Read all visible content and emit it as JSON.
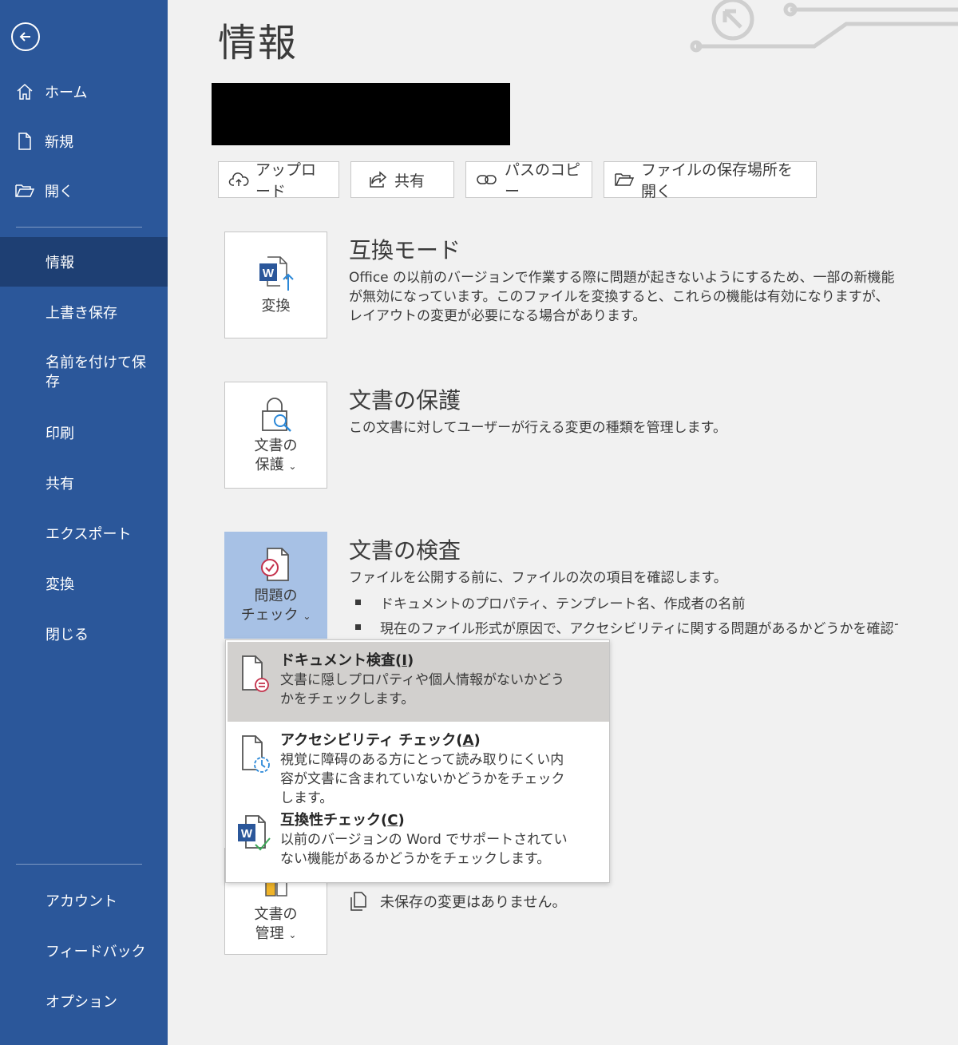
{
  "sidebar": {
    "items": [
      {
        "label": "ホーム"
      },
      {
        "label": "新規"
      },
      {
        "label": "開く"
      },
      {
        "label": "情報"
      },
      {
        "label": "上書き保存"
      },
      {
        "label": "名前を付けて保存"
      },
      {
        "label": "印刷"
      },
      {
        "label": "共有"
      },
      {
        "label": "エクスポート"
      },
      {
        "label": "変換"
      },
      {
        "label": "閉じる"
      }
    ],
    "bottom_items": [
      {
        "label": "アカウント"
      },
      {
        "label": "フィードバック"
      },
      {
        "label": "オプション"
      }
    ]
  },
  "page": {
    "title": "情報"
  },
  "toolbar": {
    "upload": "アップロード",
    "share": "共有",
    "copy_path": "パスのコピー",
    "open_location": "ファイルの保存場所を開く"
  },
  "sections": {
    "compat": {
      "button_label": "変換",
      "title": "互換モード",
      "desc": "Office の以前のバージョンで作業する際に問題が起きないようにするため、一部の新機能が無効になっています。このファイルを変換すると、これらの機能は有効になりますが、レイアウトの変更が必要になる場合があります。"
    },
    "protect": {
      "button_line1": "文書の",
      "button_line2": "保護",
      "title": "文書の保護",
      "desc": "この文書に対してユーザーが行える変更の種類を管理します。"
    },
    "inspect": {
      "button_line1": "問題の",
      "button_line2": "チェック",
      "title": "文書の検査",
      "desc": "ファイルを公開する前に、ファイルの次の項目を確認します。",
      "bullets": [
        "ドキュメントのプロパティ、テンプレート名、作成者の名前",
        "現在のファイル形式が原因で、アクセシビリティに関する問題があるかどうかを確認できな"
      ]
    },
    "manage": {
      "button_line1": "文書の",
      "button_line2": "管理",
      "status": "未保存の変更はありません。"
    }
  },
  "menu": {
    "items": [
      {
        "title": "ドキュメント検査(",
        "key": "I",
        "title_end": ")",
        "desc": "文書に隠しプロパティや個人情報がないかどうかをチェックします。"
      },
      {
        "title": "アクセシビリティ チェック(",
        "key": "A",
        "title_end": ")",
        "desc": "視覚に障碍のある方にとって読み取りにくい内容が文書に含まれていないかどうかをチェックします。"
      },
      {
        "title": "互換性チェック(",
        "key": "C",
        "title_end": ")",
        "desc": "以前のバージョンの Word でサポートされていない機能があるかどうかをチェックします。"
      }
    ]
  },
  "colors": {
    "sidebar": "#2b579a",
    "sidebar_active": "#1e3f73",
    "selected_button": "#a7c1e5",
    "word_blue": "#2b579a"
  }
}
